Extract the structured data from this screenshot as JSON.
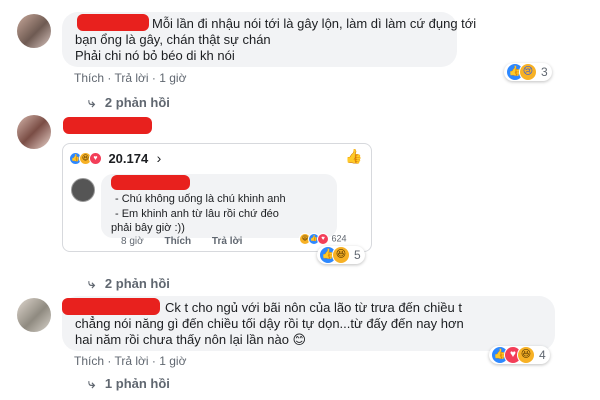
{
  "comment1": {
    "text_lines": [
      "Mỗi lần đi nhậu nói tới là gây lộn, làm dì làm cứ đụng tới",
      "bạn ổng là gây, chán thật sự chán",
      "Phải chi nó bỏ béo di kh nói"
    ],
    "like_label": "Thích",
    "reply_label": "Trả lời",
    "time": "1 giờ",
    "reaction_count": "3",
    "reactions": [
      "like-icon",
      "cry-icon"
    ],
    "replies_label": "2 phản hồi"
  },
  "comment2": {
    "shared": {
      "reaction_total": "20.174",
      "inner_comment_lines": [
        "- Chú không uống là chú khinh anh",
        "- Em khinh anh từ lâu rồi chứ đéo",
        "phải bây giờ :))"
      ],
      "time": "8 giờ",
      "like_label": "Thích",
      "reply_label": "Trả lời",
      "inner_reaction_count": "624"
    },
    "reaction_count": "5",
    "replies_label": "2 phản hồi"
  },
  "comment3": {
    "text_lines": [
      "Ck t cho ngủ với bãi nôn của lão từ trưa đến chiều t",
      "chẳng nói năng gì đến chiều tối dậy rồi tự dọn...từ đấy đến nay hơn",
      "hai năm rồi chưa thấy nôn lại lần nào 😊"
    ],
    "like_label": "Thích",
    "reply_label": "Trả lời",
    "time": "1 giờ",
    "reaction_count": "4",
    "replies_label": "1 phản hồi"
  },
  "colors": {
    "redaction": "#e8211e",
    "bubble": "#f2f3f5",
    "meta_text": "#606770",
    "like_blue": "#2d88ff"
  }
}
